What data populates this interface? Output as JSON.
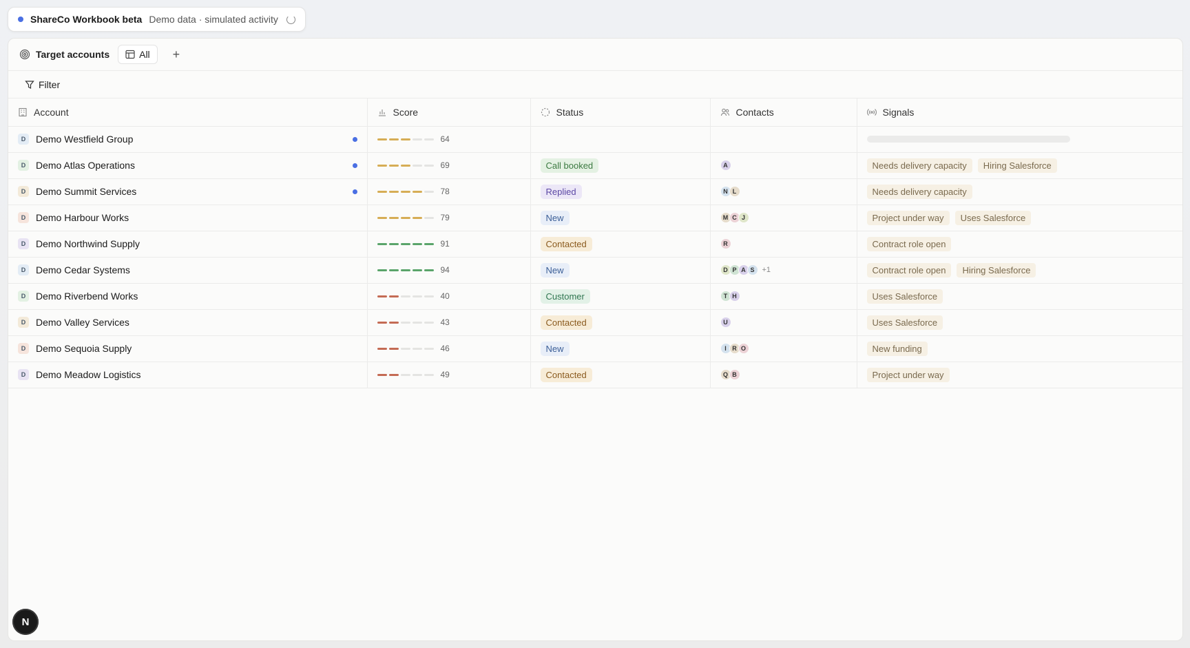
{
  "topbar": {
    "app_name": "ShareCo Workbook beta",
    "subtitle": "Demo data · simulated activity"
  },
  "view": {
    "title": "Target accounts",
    "tab_label": "All",
    "add_label": "+"
  },
  "filter": {
    "label": "Filter"
  },
  "columns": {
    "account": "Account",
    "score": "Score",
    "status": "Status",
    "contacts": "Contacts",
    "signals": "Signals"
  },
  "colors": {
    "score_mid": "#d6ad55",
    "score_high": "#5aa46a",
    "score_low": "#c46b54",
    "status_call_booked": [
      "#e4f1e3",
      "#3c7a42"
    ],
    "status_replied": [
      "#ece7f7",
      "#5b47a4"
    ],
    "status_new": [
      "#e8eef8",
      "#3c5f97"
    ],
    "status_contacted": [
      "#f7ecd7",
      "#8a5a1e"
    ],
    "status_customer": [
      "#e2f1e7",
      "#2f7650"
    ]
  },
  "rows": [
    {
      "name": "Demo Westfield Group",
      "initial": "D",
      "unread": true,
      "score": 64,
      "status": "",
      "contacts": [],
      "more": "",
      "signals": [],
      "loading": true
    },
    {
      "name": "Demo Atlas Operations",
      "initial": "D",
      "unread": true,
      "score": 69,
      "status": "Call booked",
      "contacts": [
        "A"
      ],
      "more": "",
      "signals": [
        "Needs delivery capacity",
        "Hiring Salesforce"
      ]
    },
    {
      "name": "Demo Summit Services",
      "initial": "D",
      "unread": true,
      "score": 78,
      "status": "Replied",
      "contacts": [
        "N",
        "L"
      ],
      "more": "",
      "signals": [
        "Needs delivery capacity"
      ]
    },
    {
      "name": "Demo Harbour Works",
      "initial": "D",
      "unread": false,
      "score": 79,
      "status": "New",
      "contacts": [
        "M",
        "C",
        "J"
      ],
      "more": "",
      "signals": [
        "Project under way",
        "Uses Salesforce"
      ]
    },
    {
      "name": "Demo Northwind Supply",
      "initial": "D",
      "unread": false,
      "score": 91,
      "status": "Contacted",
      "contacts": [
        "R"
      ],
      "more": "",
      "signals": [
        "Contract role open"
      ]
    },
    {
      "name": "Demo Cedar Systems",
      "initial": "D",
      "unread": false,
      "score": 94,
      "status": "New",
      "contacts": [
        "D",
        "P",
        "A",
        "S"
      ],
      "more": "+1",
      "signals": [
        "Contract role open",
        "Hiring Salesforce"
      ]
    },
    {
      "name": "Demo Riverbend Works",
      "initial": "D",
      "unread": false,
      "score": 40,
      "status": "Customer",
      "contacts": [
        "T",
        "H"
      ],
      "more": "",
      "signals": [
        "Uses Salesforce"
      ]
    },
    {
      "name": "Demo Valley Services",
      "initial": "D",
      "unread": false,
      "score": 43,
      "status": "Contacted",
      "contacts": [
        "U"
      ],
      "more": "",
      "signals": [
        "Uses Salesforce"
      ]
    },
    {
      "name": "Demo Sequoia Supply",
      "initial": "D",
      "unread": false,
      "score": 46,
      "status": "New",
      "contacts": [
        "I",
        "R",
        "O"
      ],
      "more": "",
      "signals": [
        "New funding"
      ]
    },
    {
      "name": "Demo Meadow Logistics",
      "initial": "D",
      "unread": false,
      "score": 49,
      "status": "Contacted",
      "contacts": [
        "Q",
        "B"
      ],
      "more": "",
      "signals": [
        "Project under way"
      ]
    }
  ],
  "badge": {
    "letter": "N"
  }
}
